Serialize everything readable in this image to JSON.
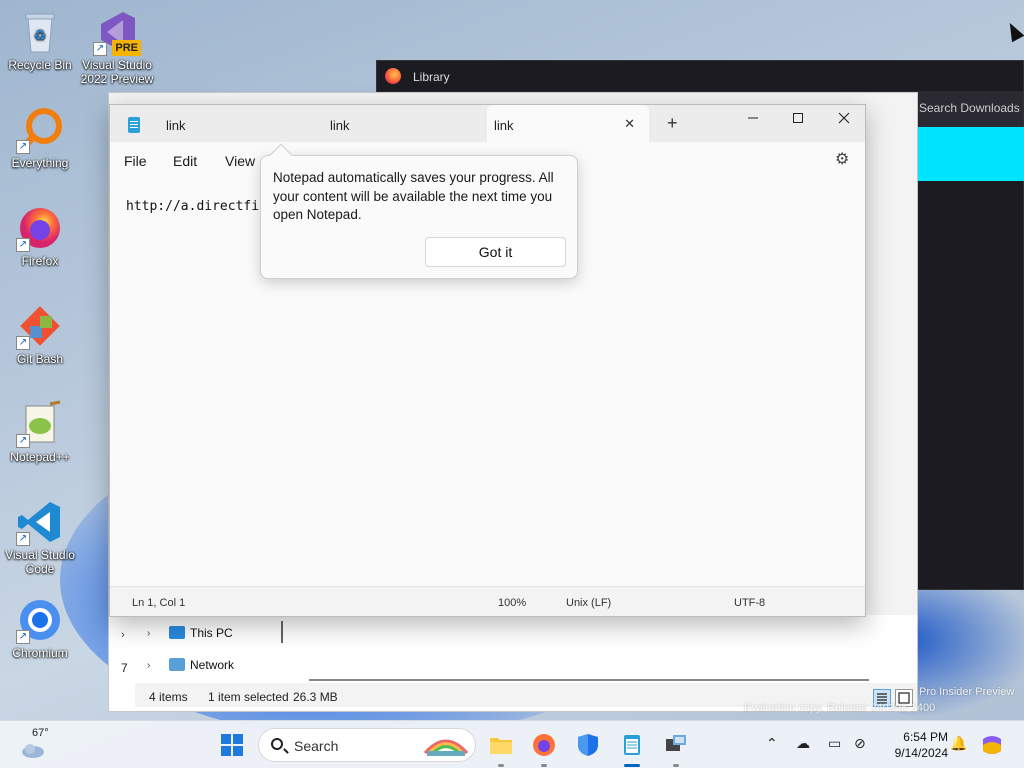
{
  "desktop": {
    "icons": [
      {
        "label": "Recycle Bin"
      },
      {
        "label": "Visual Studio 2022 Preview",
        "badge": "PRE"
      },
      {
        "label": "Everything"
      },
      {
        "label": "Firefox"
      },
      {
        "label": "Git Bash"
      },
      {
        "label": "Notepad++"
      },
      {
        "label": "Visual Studio Code"
      },
      {
        "label": "Chromium"
      }
    ],
    "watermark_line1": "Pro Insider Preview",
    "watermark_line2": "Evaluation copy. Release 240308-1400"
  },
  "library": {
    "title": "Library",
    "search_placeholder": "Search Downloads"
  },
  "explorer": {
    "nav": [
      {
        "label": "This PC"
      },
      {
        "label": "Network"
      }
    ],
    "item_count": "4 items",
    "selected": "1 item selected",
    "size": "26.3 MB",
    "side_count": "7"
  },
  "notepad": {
    "tabs": [
      {
        "label": "link"
      },
      {
        "label": "link"
      },
      {
        "label": "link"
      }
    ],
    "new_tab_symbol": "+",
    "close_tab_symbol": "✕",
    "menu": {
      "file": "File",
      "edit": "Edit",
      "view": "View"
    },
    "content": "http://a.directfi",
    "status": {
      "position": "Ln 1, Col 1",
      "zoom": "100%",
      "line_ending": "Unix (LF)",
      "encoding": "UTF-8"
    },
    "tip": {
      "text": "Notepad automatically saves your progress. All your content will be available the next time you open Notepad.",
      "button": "Got it"
    }
  },
  "taskbar": {
    "weather_temp": "67°",
    "search_label": "Search",
    "time": "6:54 PM",
    "date": "9/14/2024"
  },
  "colors": {
    "accent": "#0067c0",
    "cyan_panel": "#00e5ff"
  }
}
